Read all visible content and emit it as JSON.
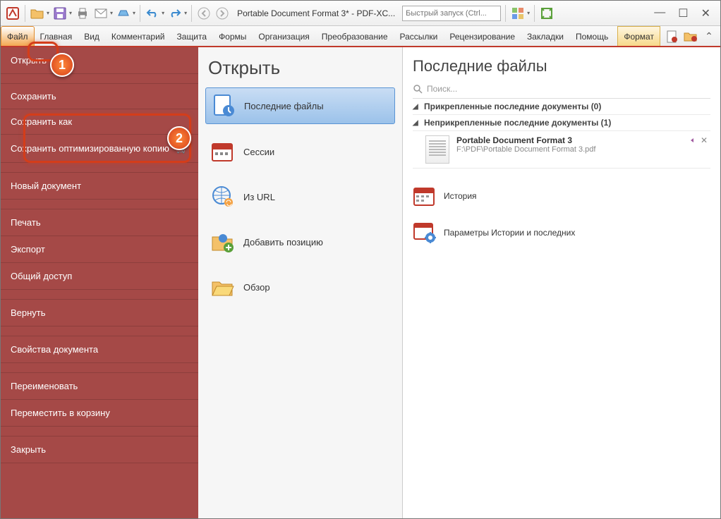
{
  "window": {
    "title": "Portable Document Format 3* - PDF-XC..."
  },
  "toolbar": {
    "quick_placeholder": "Быстрый запуск (Ctrl..."
  },
  "ribbon": {
    "tabs": [
      "Файл",
      "Главная",
      "Вид",
      "Комментарий",
      "Защита",
      "Формы",
      "Организация",
      "Преобразование",
      "Рассылки",
      "Рецензирование",
      "Закладки",
      "Помощь"
    ],
    "format_tab": "Формат"
  },
  "sidebar": {
    "items": [
      {
        "label": "Открыть"
      },
      {
        "label": "Сохранить"
      },
      {
        "label": "Сохранить как"
      },
      {
        "label": "Сохранить оптимизированную копию",
        "icon": "cart"
      },
      {
        "label": "Новый документ"
      },
      {
        "label": "Печать"
      },
      {
        "label": "Экспорт"
      },
      {
        "label": "Общий доступ"
      },
      {
        "label": "Вернуть"
      },
      {
        "label": "Свойства документа"
      },
      {
        "label": "Переименовать"
      },
      {
        "label": "Переместить в корзину"
      },
      {
        "label": "Закрыть"
      }
    ]
  },
  "mid": {
    "title": "Открыть",
    "items": [
      "Последние файлы",
      "Сессии",
      "Из URL",
      "Добавить позицию",
      "Обзор"
    ]
  },
  "right": {
    "title": "Последние файлы",
    "search_placeholder": "Поиск...",
    "pinned_header": "Прикрепленные последние документы (0)",
    "unpinned_header": "Неприкрепленные последние документы (1)",
    "doc": {
      "name": "Portable Document Format 3",
      "path": "F:\\PDF\\Portable Document Format 3.pdf"
    },
    "history": "История",
    "history_params": "Параметры Истории и последних"
  }
}
